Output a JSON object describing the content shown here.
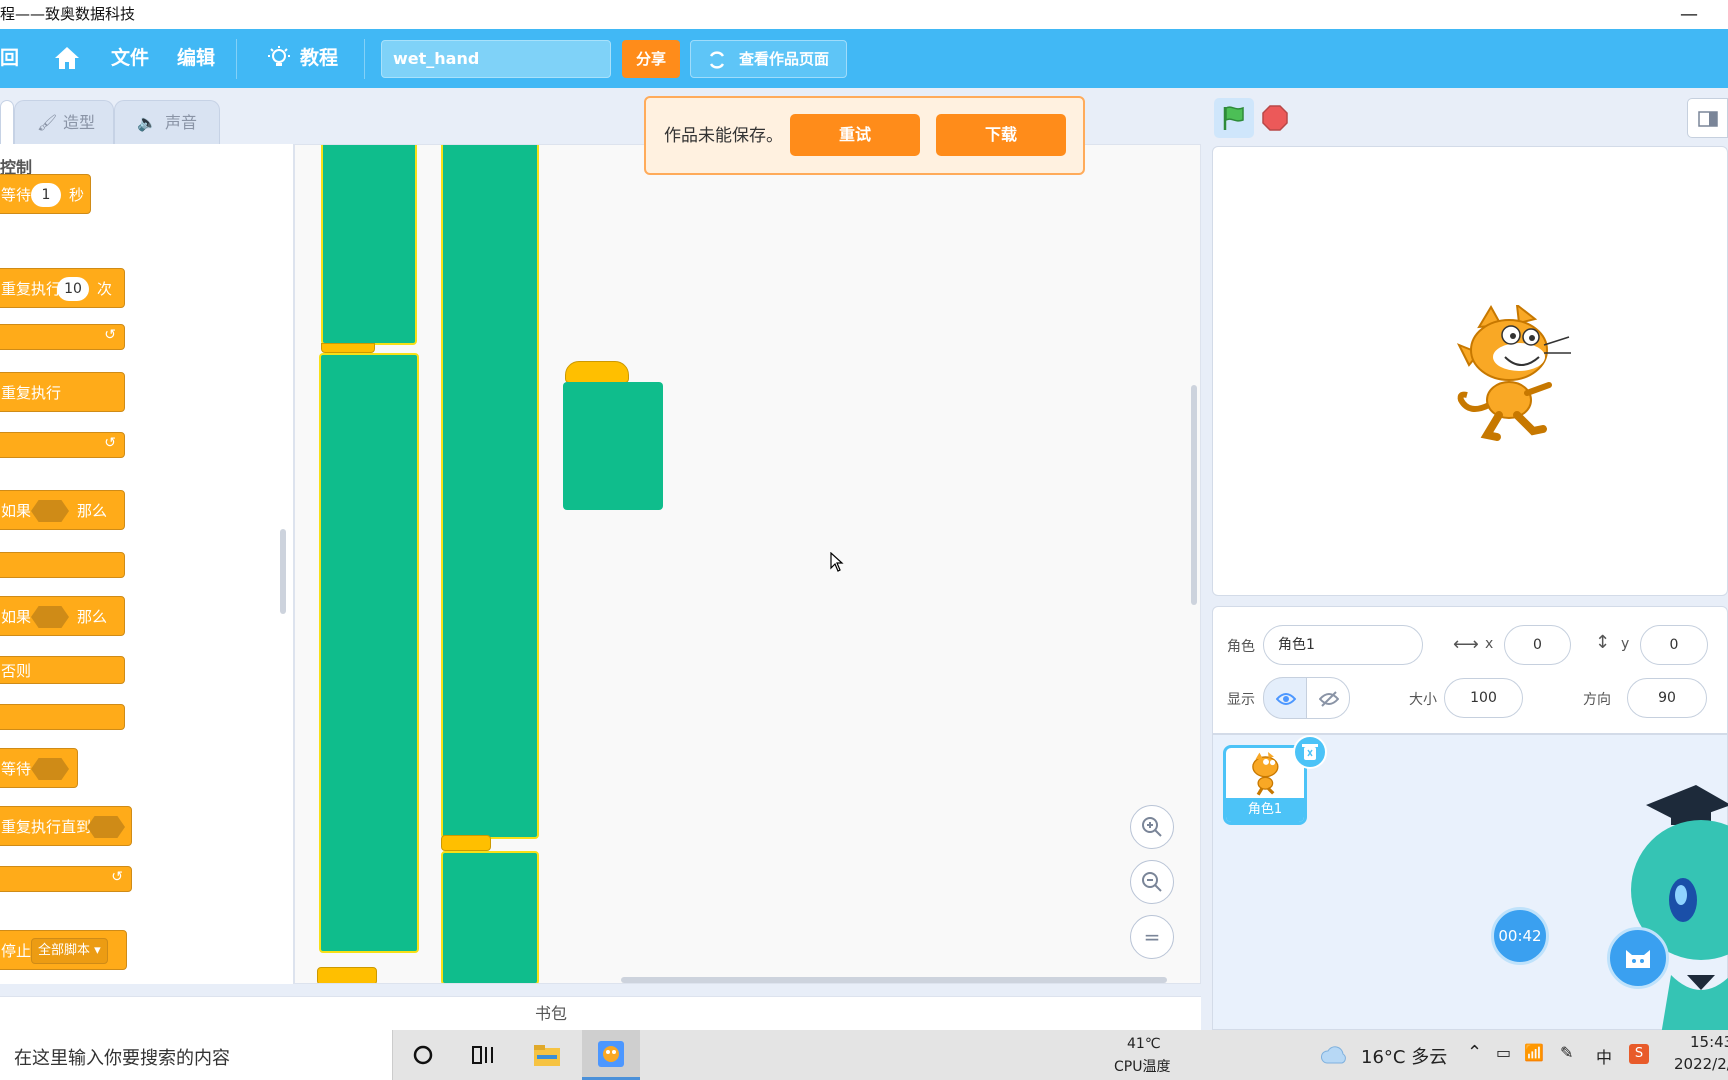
{
  "window": {
    "title": "程——致奥数据科技",
    "minimize": "—"
  },
  "menubar": {
    "back": "回",
    "file": "文件",
    "edit": "编辑",
    "tutorial": "教程",
    "project_name": "wet_hand",
    "share": "分享",
    "view_page": "查看作品页面"
  },
  "tabs": {
    "costumes": "造型",
    "sounds": "声音"
  },
  "palette": {
    "category": "控制",
    "blocks": {
      "wait": "等待",
      "wait_value": "1",
      "wait_unit": "秒",
      "repeat": "重复执行",
      "repeat_value": "10",
      "repeat_unit": "次",
      "forever": "重复执行",
      "if": "如果",
      "then": "那么",
      "if2": "如果",
      "then2": "那么",
      "else": "否则",
      "wait_until": "等待",
      "repeat_until": "重复执行直到",
      "stop": "停止",
      "stop_option": "全部脚本 ▾"
    }
  },
  "notice": {
    "message": "作品未能保存。",
    "retry": "重试",
    "download": "下载"
  },
  "sprite_info": {
    "sprite_label": "角色",
    "sprite_name": "角色1",
    "x_label": "x",
    "x_value": "0",
    "y_label": "y",
    "y_value": "0",
    "show_label": "显示",
    "size_label": "大小",
    "size_value": "100",
    "direction_label": "方向",
    "direction_value": "90"
  },
  "sprite_list": [
    {
      "name": "角色1"
    }
  ],
  "timer": "00:42",
  "backpack": "书包",
  "taskbar": {
    "search_placeholder": "在这里输入你要搜索的内容",
    "cpu_temp": "41℃",
    "cpu_label": "CPU温度",
    "weather": "16°C 多云",
    "time": "15:43",
    "date": "2022/2/..."
  },
  "colors": {
    "menubar": "#41b8f5",
    "accent_orange": "#ff8c1a",
    "control_block": "#ffab19",
    "music_block": "#0fbd8c",
    "highlight": "#f7e017"
  }
}
